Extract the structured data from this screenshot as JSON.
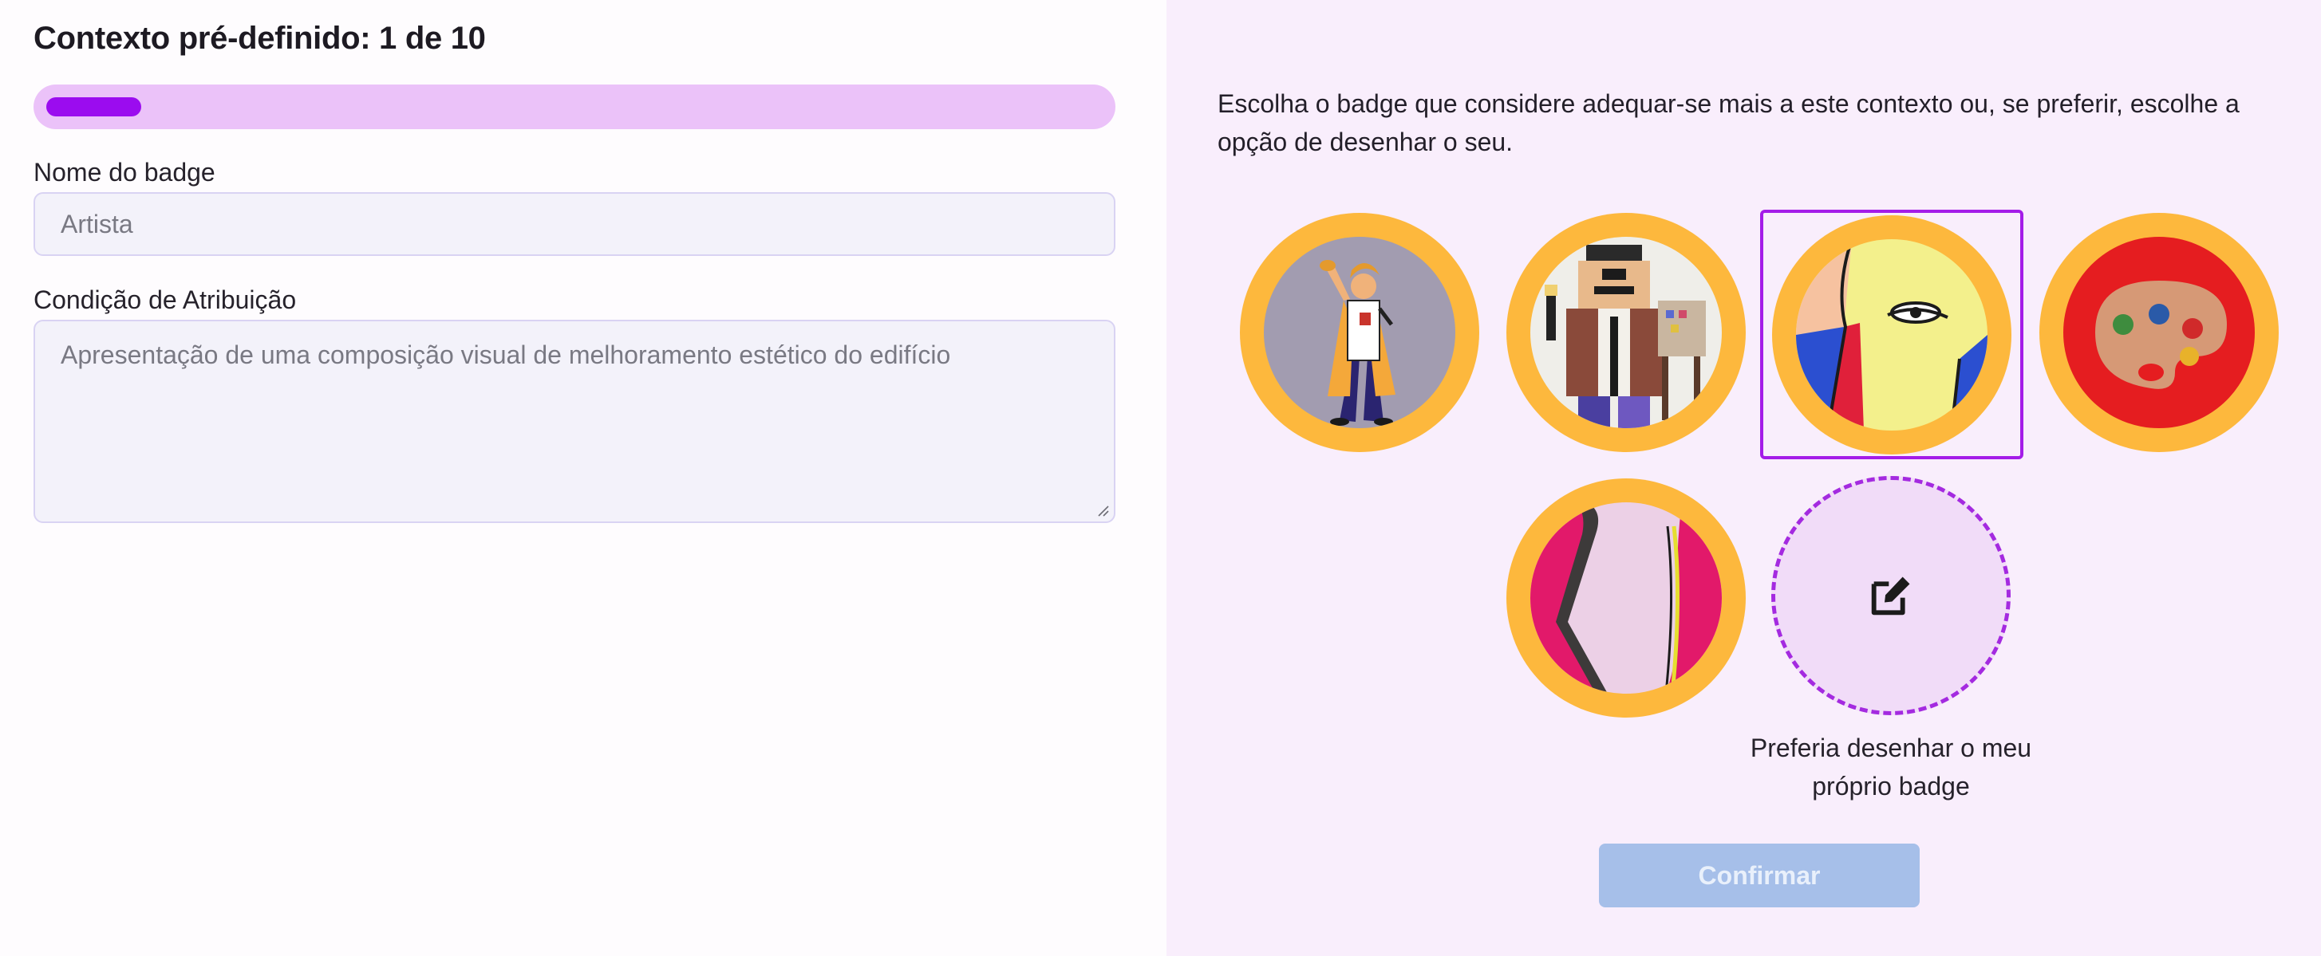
{
  "form": {
    "title": "Contexto pré-definido: 1 de 10",
    "progress": {
      "current": 1,
      "total": 10,
      "fill_color": "#9b0cef",
      "track_color": "#ebc2f9"
    },
    "name_label": "Nome do badge",
    "name_value": "Artista",
    "condition_label": "Condição de Atribuição",
    "condition_value": "Apresentação de uma composição visual de melhoramento estético do edifício"
  },
  "chooser": {
    "instructions": "Escolha o badge que considere adequar-se mais a este contexto ou, se preferir, escolhe a opção de desenhar o seu.",
    "badges": [
      {
        "name": "artist-figure",
        "selected": false
      },
      {
        "name": "pixel-painter",
        "selected": false
      },
      {
        "name": "abstract-face",
        "selected": true
      },
      {
        "name": "paint-palette",
        "selected": false
      },
      {
        "name": "abstract-shapes",
        "selected": false
      }
    ],
    "draw_option": {
      "icon": "edit-icon",
      "label": "Preferia desenhar o meu próprio badge"
    },
    "confirm_label": "Confirmar"
  },
  "colors": {
    "accent": "#a41ce8",
    "badge_ring": "#fdb83d",
    "confirm_disabled": "#a6bfe9"
  }
}
